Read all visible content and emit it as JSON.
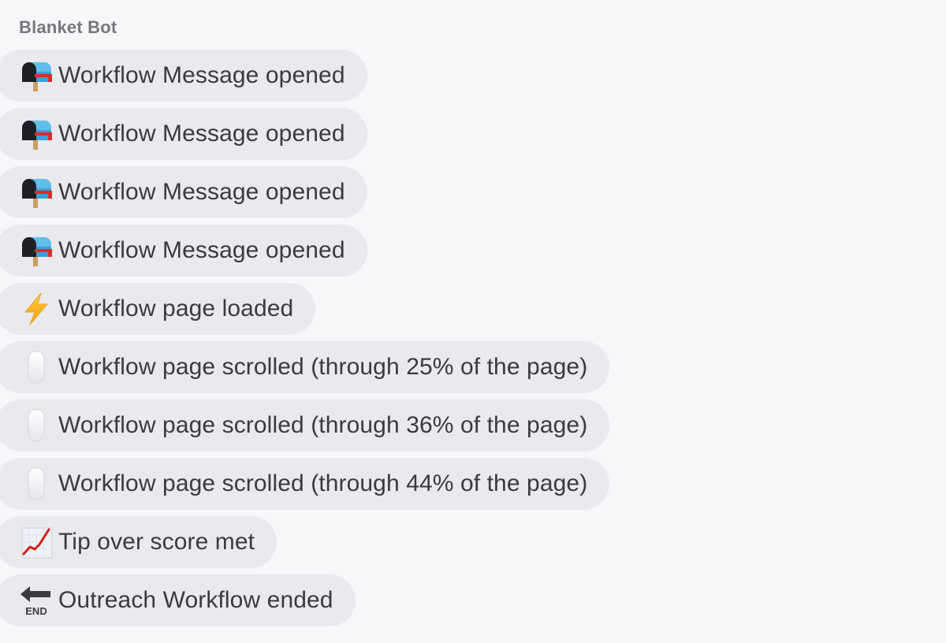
{
  "sender": "Blanket Bot",
  "events": [
    {
      "icon": "mailbox-icon",
      "label": "Workflow Message opened"
    },
    {
      "icon": "mailbox-icon",
      "label": "Workflow Message opened"
    },
    {
      "icon": "mailbox-icon",
      "label": "Workflow Message opened"
    },
    {
      "icon": "mailbox-icon",
      "label": "Workflow Message opened"
    },
    {
      "icon": "lightning-icon",
      "label": "Workflow page loaded"
    },
    {
      "icon": "mouse-icon",
      "label": "Workflow page scrolled (through 25% of the page)"
    },
    {
      "icon": "mouse-icon",
      "label": "Workflow page scrolled (through 36% of the page)"
    },
    {
      "icon": "mouse-icon",
      "label": "Workflow page scrolled (through 44% of the page)"
    },
    {
      "icon": "chart-increasing-icon",
      "label": "Tip over score met"
    },
    {
      "icon": "end-arrow-icon",
      "label": "Outreach Workflow ended"
    }
  ]
}
